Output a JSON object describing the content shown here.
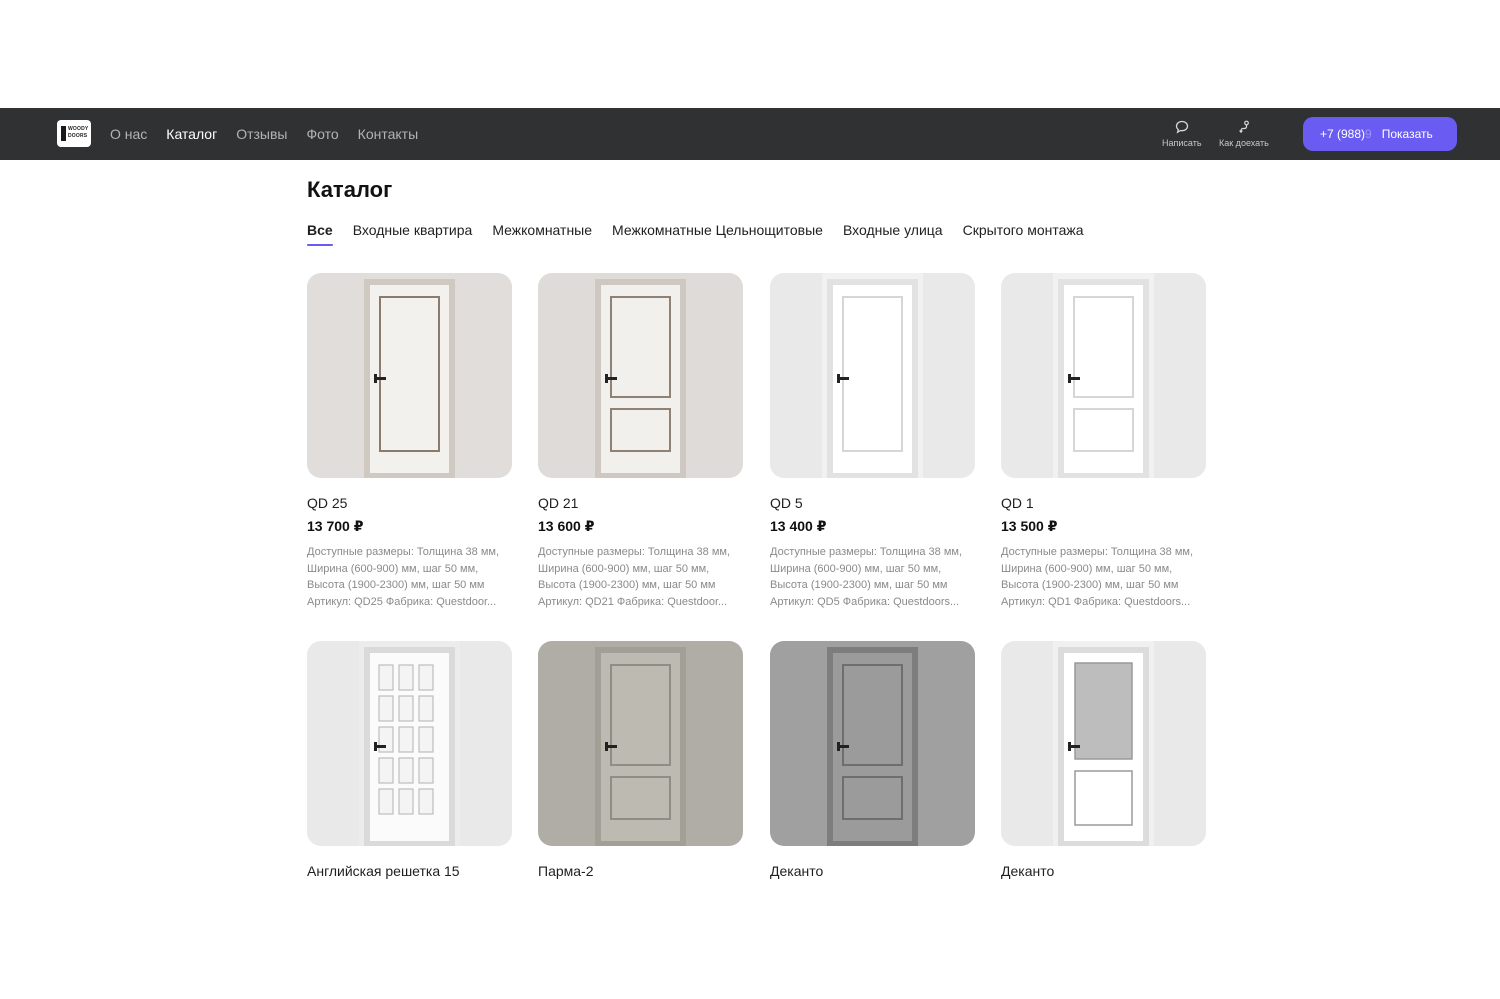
{
  "brand": {
    "logo_text": "WOODY DOORS"
  },
  "nav": {
    "links": [
      "О нас",
      "Каталог",
      "Отзывы",
      "Фото",
      "Контакты"
    ],
    "active_index": 1,
    "actions": [
      {
        "label": "Написать",
        "icon": "chat-bubble-icon"
      },
      {
        "label": "Как доехать",
        "icon": "route-icon"
      }
    ],
    "phone": {
      "number": "+7 (988)",
      "hidden_tail": " 9",
      "show_label": "Показать"
    }
  },
  "page": {
    "title": "Каталог",
    "tabs": [
      "Все",
      "Входные квартира",
      "Межкомнатные",
      "Межкомнатные Цельнощитовые",
      "Входные улица",
      "Скрытого монтажа"
    ],
    "active_tab": 0
  },
  "products": [
    {
      "name": "QD 25",
      "price": "13 700 ₽",
      "desc": "Доступные размеры: Толщина 38 мм,\nШирина (600-900) мм, шаг 50 мм,\nВысота (1900-2300) мм, шаг 50 мм\nАртикул: QD25 Фабрика: Questdoor...",
      "bg": "#e8e5e2",
      "door": "#f3f1ee",
      "frame": "#cfc9c2",
      "inner": "#8a7b6d",
      "style": "single-panel"
    },
    {
      "name": "QD 21",
      "price": "13 600 ₽",
      "desc": "Доступные размеры: Толщина 38 мм,\nШирина (600-900) мм, шаг 50 мм,\nВысота (1900-2300) мм, шаг 50 мм\nАртикул: QD21 Фабрика: Questdoor...",
      "bg": "#e6e3e0",
      "door": "#f2f0ed",
      "frame": "#cec8c1",
      "inner": "#8f8174",
      "style": "two-panel"
    },
    {
      "name": "QD 5",
      "price": "13 400 ₽",
      "desc": "Доступные размеры: Толщина 38 мм,\nШирина (600-900) мм, шаг 50 мм,\nВысота (1900-2300) мм, шаг 50 мм\nАртикул: QD5 Фабрика: Questdoors...",
      "bg": "#f1f1f1",
      "door": "#ffffff",
      "frame": "#e2e2e2",
      "inner": "#d6d6d6",
      "style": "single-panel-white"
    },
    {
      "name": "QD 1",
      "price": "13 500 ₽",
      "desc": "Доступные размеры: Толщина 38 мм,\nШирина (600-900) мм, шаг 50 мм,\nВысота (1900-2300) мм, шаг 50 мм\nАртикул: QD1 Фабрика: Questdoors...",
      "bg": "#f1f1f1",
      "door": "#ffffff",
      "frame": "#e2e2e2",
      "inner": "#d6d6d6",
      "style": "two-panel-white"
    },
    {
      "name": "Английская решетка 15",
      "price": "",
      "desc": "",
      "bg": "#ececec",
      "door": "#fbfbfb",
      "frame": "#dadada",
      "inner": "#bdbdbd",
      "style": "grid"
    },
    {
      "name": "Парма-2",
      "price": "",
      "desc": "",
      "bg": "#b5b3ab",
      "door": "#bcbab1",
      "frame": "#a19f96",
      "inner": "#8f8d85",
      "style": "two-panel-dark"
    },
    {
      "name": "Деканто",
      "price": "",
      "desc": "",
      "bg": "#a6a6a6",
      "door": "#9b9b9b",
      "frame": "#7d7d7d",
      "inner": "#6e6e6e",
      "style": "two-panel-dark"
    },
    {
      "name": "Деканто",
      "price": "",
      "desc": "",
      "bg": "#f0f0f0",
      "door": "#ffffff",
      "frame": "#dcdcdc",
      "inner": "#9a9a9a",
      "style": "glass"
    }
  ]
}
